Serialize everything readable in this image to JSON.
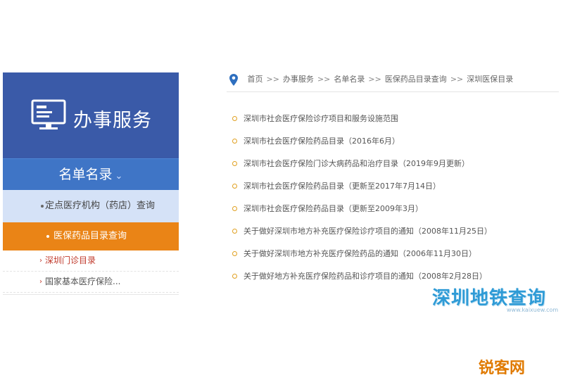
{
  "sidebar": {
    "title": "办事服务",
    "subnav": {
      "label": "名单名录",
      "chevron": "⌄"
    },
    "items": [
      {
        "label": "定点医疗机构（药店）查询"
      },
      {
        "label": "医保药品目录查询"
      }
    ],
    "links": [
      {
        "label": "深圳门诊目录"
      },
      {
        "label": "国家基本医疗保险..."
      }
    ]
  },
  "breadcrumb": {
    "icon": "location-pin-icon",
    "items": [
      "首页",
      "办事服务",
      "名单名录",
      "医保药品目录查询",
      "深圳医保目录"
    ],
    "separator": ">>"
  },
  "articles": [
    "深圳市社会医疗保险诊疗项目和服务设施范围",
    "深圳市社会医疗保险药品目录（2016年6月）",
    "深圳市社会医疗保险门诊大病药品和治疗目录（2019年9月更新）",
    "深圳市社会医疗保险药品目录（更新至2017年7月14日）",
    "深圳市社会医疗保险药品目录（更新至2009年3月）",
    "关于做好深圳市地方补充医疗保险诊疗项目的通知（2008年11月25日）",
    "关于做好深圳市地方补充医疗保险药品的通知（2006年11月30日）",
    "关于做好地方补充医疗保险药品和诊疗项目的通知（2008年2月28日）"
  ],
  "watermarks": {
    "site1": "深圳地铁查询",
    "site1_url": "www.kaixuew.com",
    "site2": "锐客网"
  },
  "colors": {
    "header_blue": "#3a5aa8",
    "subnav_blue": "#3f75c6",
    "active_orange": "#ea8416",
    "light_item": "#d5e2f7",
    "bullet": "#e0a020"
  }
}
